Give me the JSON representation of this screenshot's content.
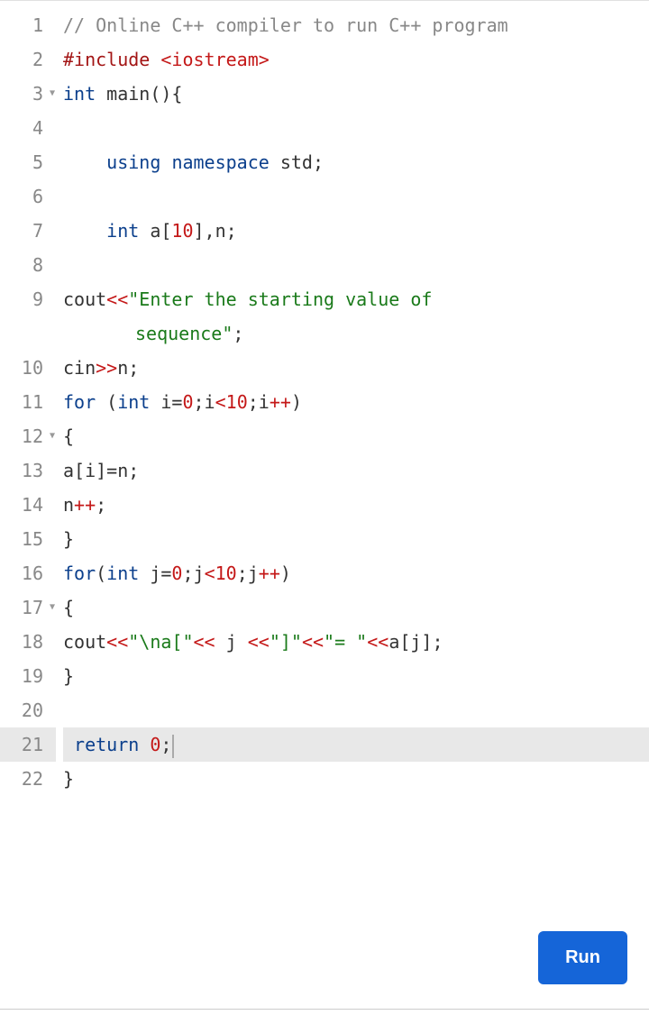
{
  "editor": {
    "highlighted_line": 21,
    "lines": [
      {
        "num": "1",
        "fold": false
      },
      {
        "num": "2",
        "fold": false
      },
      {
        "num": "3",
        "fold": true
      },
      {
        "num": "4",
        "fold": false
      },
      {
        "num": "5",
        "fold": false
      },
      {
        "num": "6",
        "fold": false
      },
      {
        "num": "7",
        "fold": false
      },
      {
        "num": "8",
        "fold": false
      },
      {
        "num": "9",
        "fold": false
      },
      {
        "num": "",
        "fold": false
      },
      {
        "num": "10",
        "fold": false
      },
      {
        "num": "11",
        "fold": false
      },
      {
        "num": "12",
        "fold": true
      },
      {
        "num": "13",
        "fold": false
      },
      {
        "num": "14",
        "fold": false
      },
      {
        "num": "15",
        "fold": false
      },
      {
        "num": "16",
        "fold": false
      },
      {
        "num": "17",
        "fold": true
      },
      {
        "num": "18",
        "fold": false
      },
      {
        "num": "19",
        "fold": false
      },
      {
        "num": "20",
        "fold": false
      },
      {
        "num": "21",
        "fold": false
      },
      {
        "num": "22",
        "fold": false
      }
    ],
    "code": {
      "l1_comment": "// Online C++ compiler to run C++ program",
      "l2_include": "#include",
      "l2_lib": "<iostream>",
      "l3_int": "int",
      "l3_main": " main(){",
      "l5_using": "using",
      "l5_namespace": "namespace",
      "l5_std": " std;",
      "l7_int": "int",
      "l7_decl_a": " a[",
      "l7_ten": "10",
      "l7_decl_rest": "],n;",
      "l9_cout": "cout",
      "l9_op": "<<",
      "l9_str": "\"Enter the starting value of ",
      "l9b_str": "sequence\"",
      "l9b_semi": ";",
      "l10_cin": "cin",
      "l10_op": ">>",
      "l10_rest": "n;",
      "l11_for": "for",
      "l11_open": " (",
      "l11_int": "int",
      "l11_i": " i=",
      "l11_zero": "0",
      "l11_semi1": ";i",
      "l11_lt": "<",
      "l11_ten": "10",
      "l11_semi2": ";i",
      "l11_pp": "++",
      "l11_close": ")",
      "l12_brace": "{",
      "l13_assign": "a[i]=n;",
      "l14_n": "n",
      "l14_pp": "++",
      "l14_semi": ";",
      "l15_brace": "}",
      "l16_for": "for",
      "l16_open": "(",
      "l16_int": "int",
      "l16_j": " j=",
      "l16_zero": "0",
      "l16_semi1": ";j",
      "l16_lt": "<",
      "l16_ten": "10",
      "l16_semi2": ";j",
      "l16_pp": "++",
      "l16_close": ")",
      "l17_brace": "{",
      "l18_cout": "cout",
      "l18_op1": "<<",
      "l18_str1": "\"\\na[\"",
      "l18_op2": "<<",
      "l18_j": " j ",
      "l18_op3": "<<",
      "l18_str2": "\"]\"",
      "l18_op4": "<<",
      "l18_str3": "\"= \"",
      "l18_op5": "<<",
      "l18_rest": "a[j];",
      "l19_brace": "}",
      "l21_return": "return",
      "l21_space": " ",
      "l21_zero": "0",
      "l21_semi": ";",
      "l22_brace": "}"
    }
  },
  "buttons": {
    "run": "Run"
  }
}
